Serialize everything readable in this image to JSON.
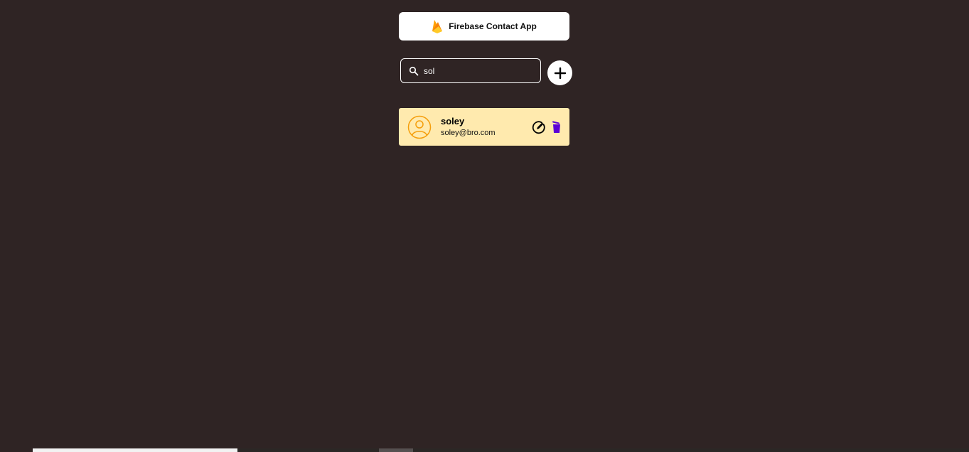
{
  "header": {
    "title": "Firebase Contact App",
    "logo_icon": "firebase-flame-icon"
  },
  "search": {
    "value": "sol",
    "icon": "search-icon"
  },
  "add_button": {
    "icon": "plus-icon"
  },
  "contacts": [
    {
      "name": "soley",
      "email": "soley@bro.com",
      "avatar_icon": "user-circle-icon",
      "edit_icon": "edit-icon",
      "delete_icon": "trash-icon"
    }
  ],
  "colors": {
    "background": "#2f2424",
    "card": "#ffeaae",
    "avatar": "#f59e0b",
    "delete": "#5b00d6",
    "flame_orange": "#f6820c",
    "flame_yellow": "#ffca28"
  }
}
